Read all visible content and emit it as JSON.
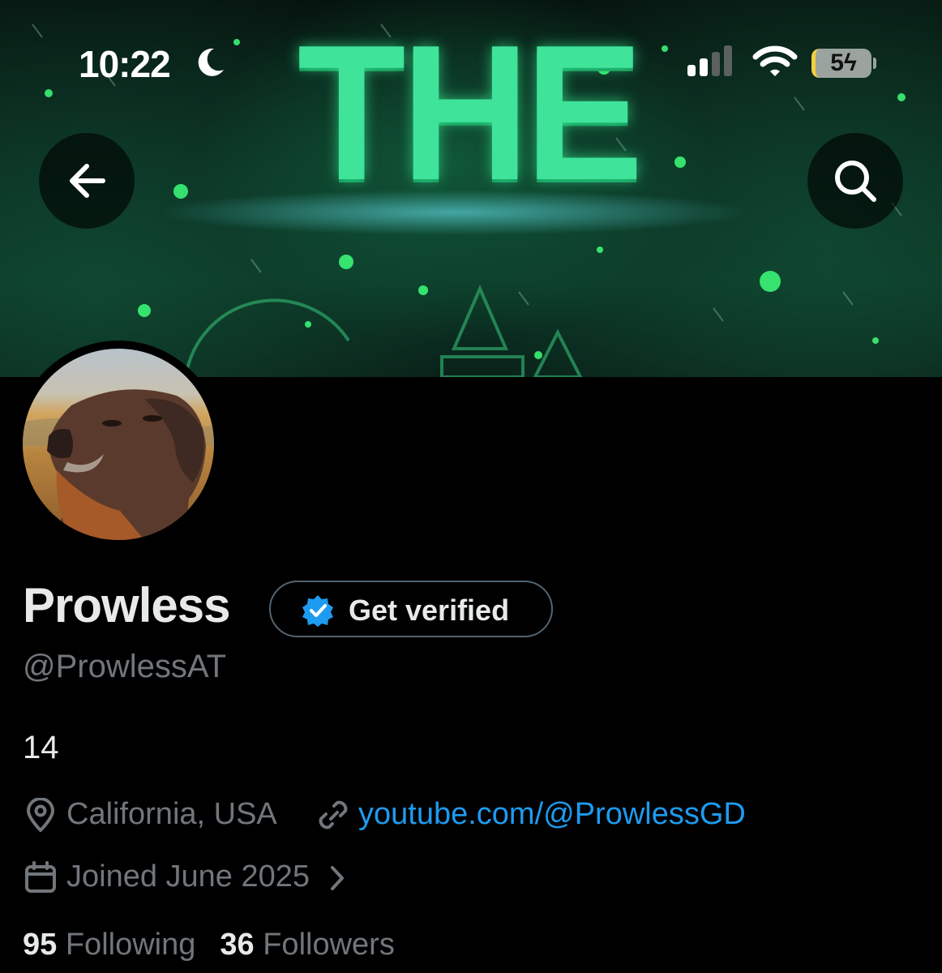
{
  "status_bar": {
    "time": "10:22",
    "battery": "5",
    "icons": [
      "moon-icon",
      "cellular-signal-icon",
      "wifi-icon",
      "battery-charging-icon"
    ]
  },
  "header": {
    "banner_text": "THE",
    "back_icon": "arrow-left-icon",
    "search_icon": "search-icon"
  },
  "profile": {
    "display_name": "Prowless",
    "get_verified_label": "Get verified",
    "handle": "@ProwlessAT",
    "bio": "14",
    "location": "California, USA",
    "website": "youtube.com/@ProwlessGD",
    "joined": "Joined June 2025",
    "following_count": "95",
    "following_label": "Following",
    "followers_count": "36",
    "followers_label": "Followers"
  },
  "colors": {
    "background": "#000000",
    "text_primary": "#e7e9ea",
    "text_secondary": "#71767b",
    "link": "#1d9bf0",
    "banner_green": "#3fe39a"
  }
}
